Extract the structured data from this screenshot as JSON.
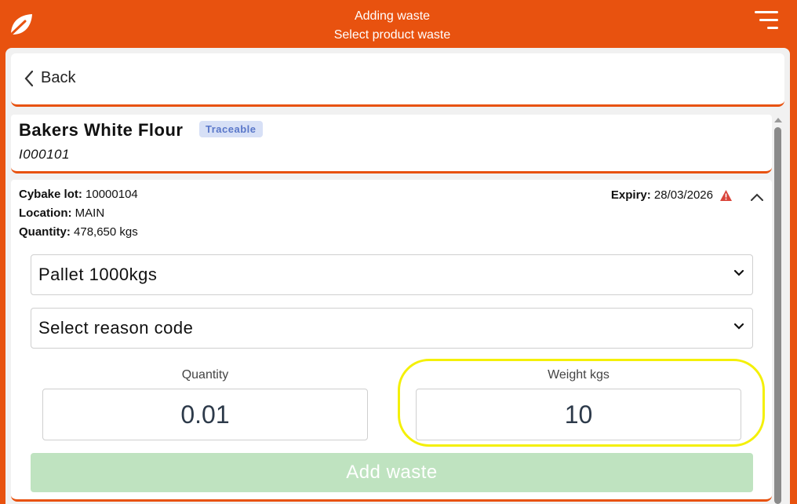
{
  "header": {
    "title": "Adding waste",
    "subtitle": "Select product waste",
    "logo_icon": "leaf-icon",
    "menu_icon": "menu-icon"
  },
  "nav": {
    "back_label": "Back"
  },
  "product": {
    "name": "Bakers White Flour",
    "badge": "Traceable",
    "code": "I000101"
  },
  "lot": {
    "lot_label": "Cybake lot:",
    "lot_value": "10000104",
    "location_label": "Location:",
    "location_value": "MAIN",
    "quantity_label": "Quantity:",
    "quantity_value": "478,650 kgs",
    "expiry_label": "Expiry:",
    "expiry_value": "28/03/2026"
  },
  "form": {
    "unit_select": "Pallet 1000kgs",
    "reason_select": "Select reason code",
    "quantity_label": "Quantity",
    "quantity_value": "0.01",
    "weight_label": "Weight kgs",
    "weight_value": "10",
    "add_button": "Add waste"
  },
  "colors": {
    "brand": "#e8520f",
    "badge_bg": "#d7e0f6",
    "badge_text": "#5a77c9",
    "button_disabled": "#bfe3c0",
    "highlight": "#f4f008"
  }
}
